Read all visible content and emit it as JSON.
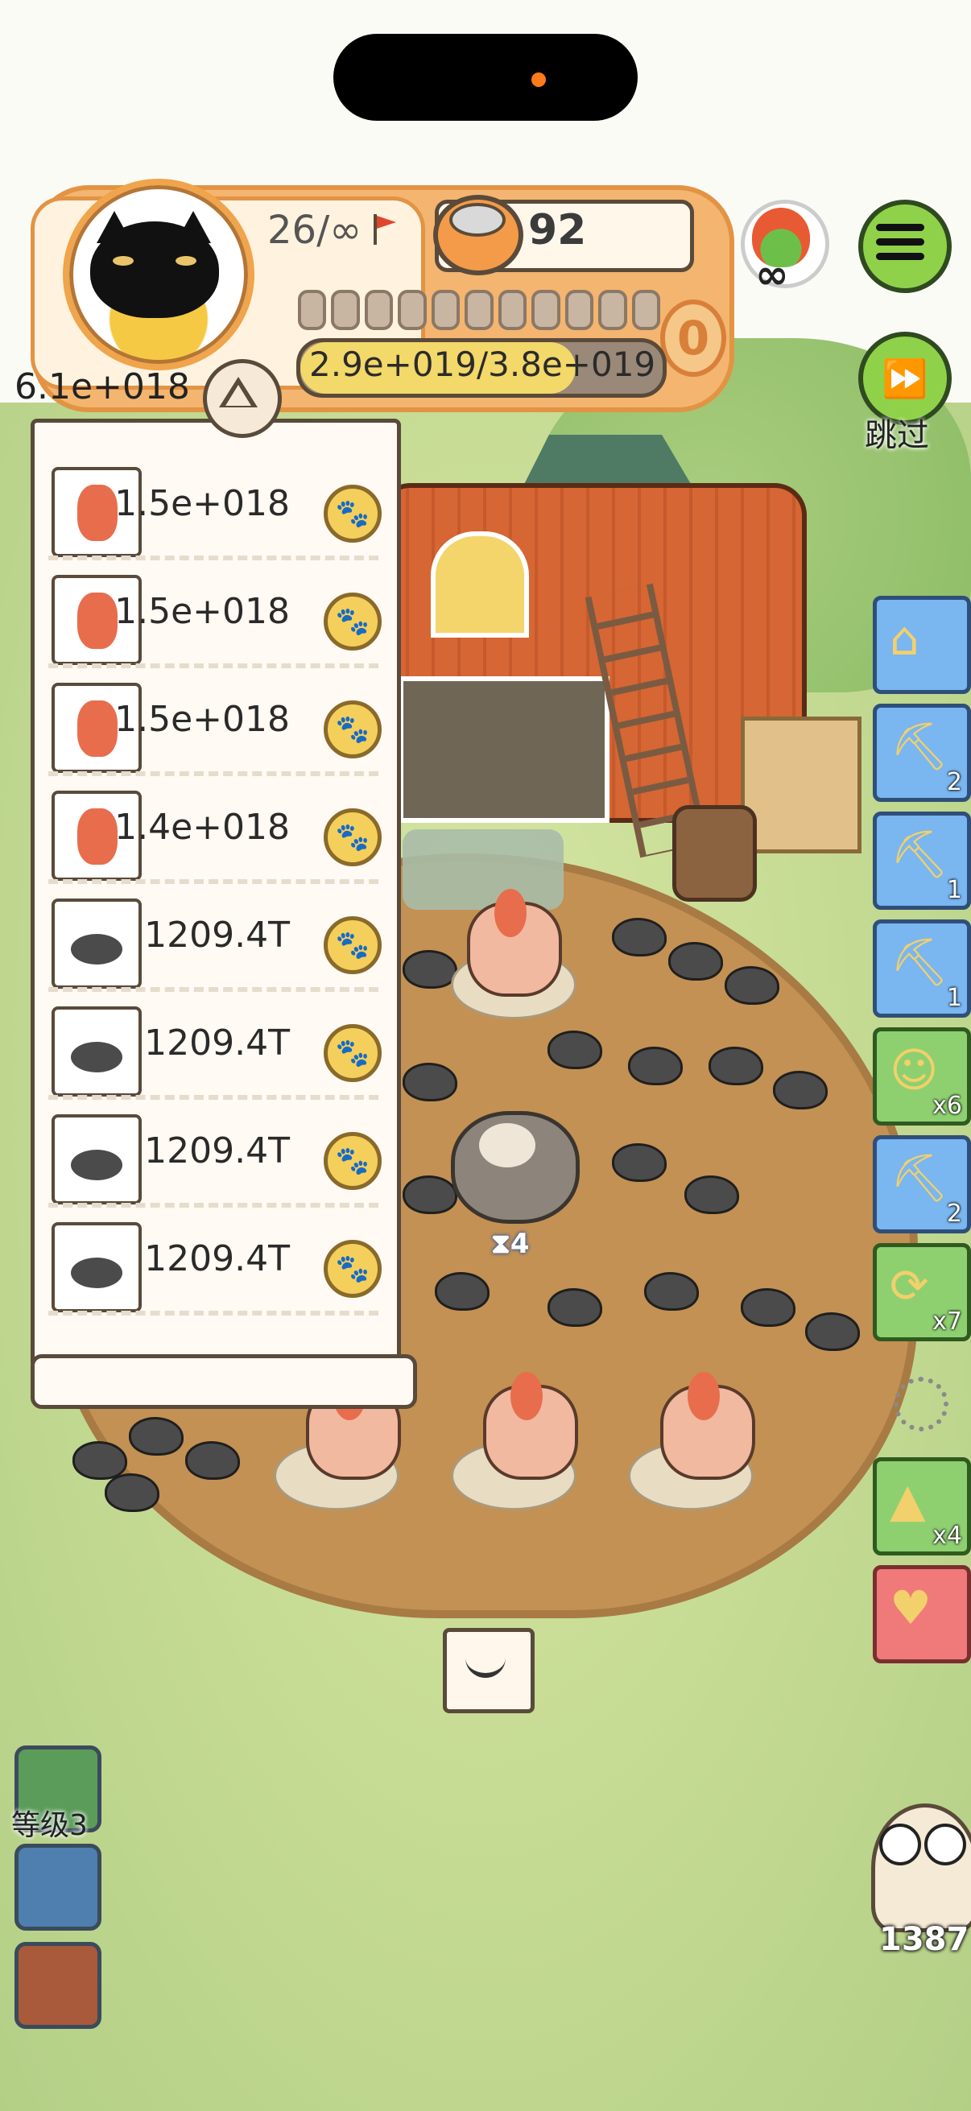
{
  "hud": {
    "level_text": "26/∞",
    "coins": "92",
    "exp_text": "2.9e+019/3.8e+019",
    "exp_progress": 0.76,
    "badge_value": "0",
    "fire_label": "∞",
    "skip_label": "跳过",
    "segments": 11
  },
  "panel": {
    "total_value": "6.1e+018",
    "rows": [
      {
        "icon": "mermaid-chicken-icon",
        "value": "1.5e+018"
      },
      {
        "icon": "mermaid-chicken-icon",
        "value": "1.5e+018"
      },
      {
        "icon": "mermaid-chicken-icon",
        "value": "1.5e+018"
      },
      {
        "icon": "mermaid-chicken-icon",
        "value": "1.4e+018"
      },
      {
        "icon": "mole-icon",
        "value": "1209.4T"
      },
      {
        "icon": "mole-icon",
        "value": "1209.4T"
      },
      {
        "icon": "mole-icon",
        "value": "1209.4T"
      },
      {
        "icon": "mole-icon",
        "value": "1209.4T"
      }
    ]
  },
  "field": {
    "sloth_timer": "4"
  },
  "tools": [
    {
      "name": "hut-tool",
      "count": ""
    },
    {
      "name": "shovel-tool",
      "count": "2"
    },
    {
      "name": "shovel-tool",
      "count": "1"
    },
    {
      "name": "shovel-tool",
      "count": "1"
    },
    {
      "name": "worker-tool",
      "count": "x6"
    },
    {
      "name": "shovel-tool",
      "count": "2"
    },
    {
      "name": "refresh-ticket-tool",
      "count": "x7"
    },
    {
      "name": "tent-tool",
      "count": "x4"
    },
    {
      "name": "heart-tool",
      "count": ""
    }
  ],
  "left_buttons": {
    "level_label": "等级3"
  },
  "owl": {
    "count": "1387"
  },
  "colors": {
    "hud_orange": "#f3b56f",
    "button_green": "#8fd24a",
    "tool_blue": "#7ab6f0"
  }
}
